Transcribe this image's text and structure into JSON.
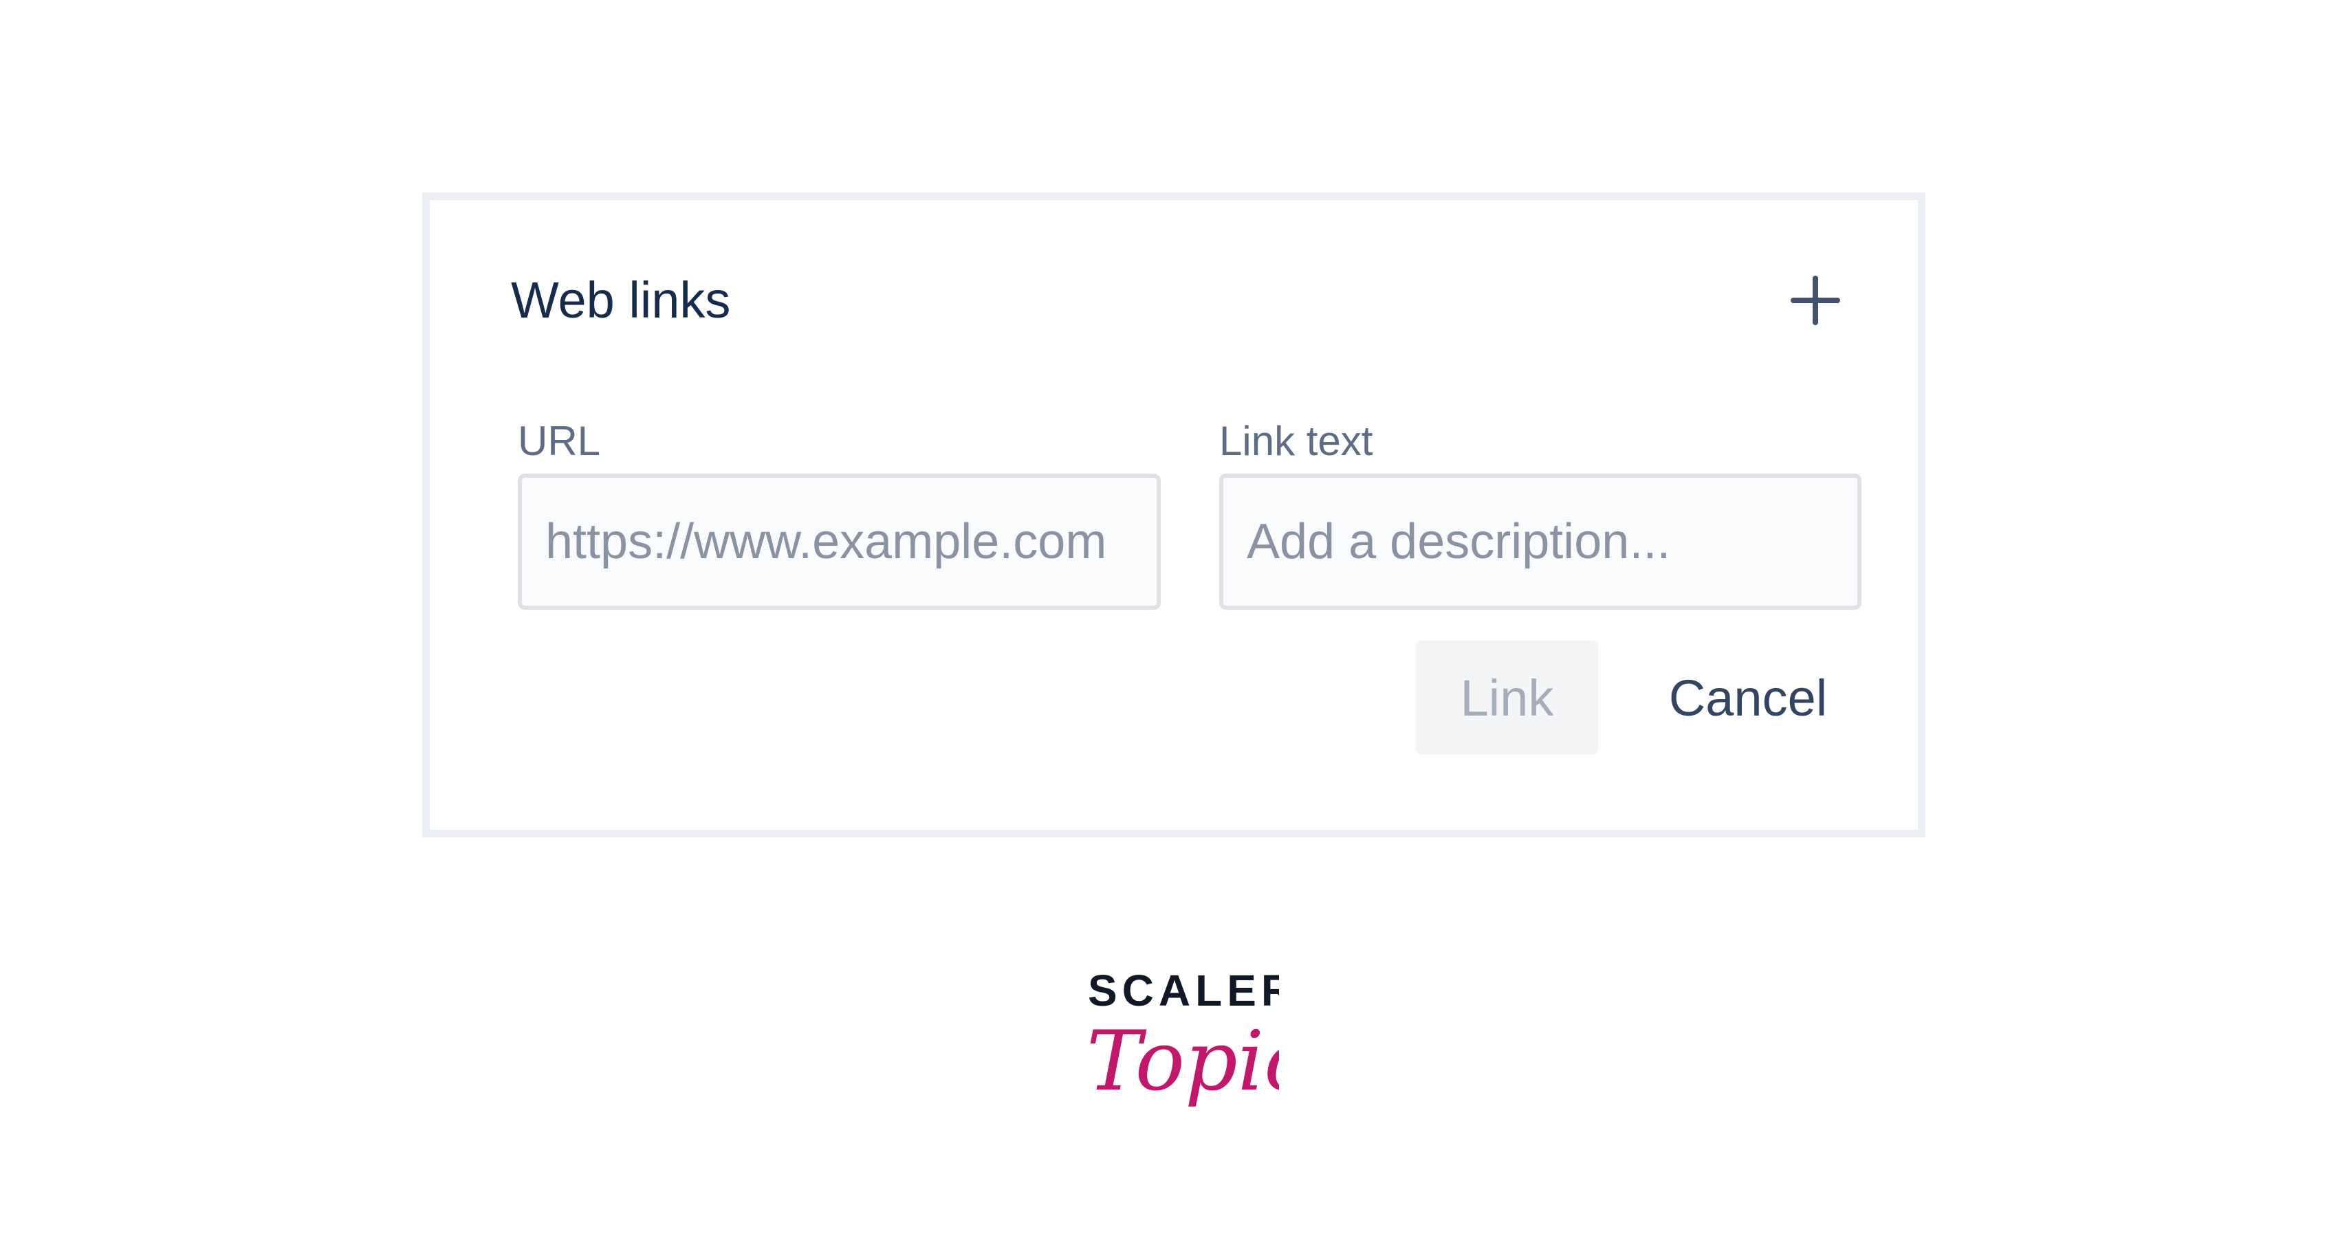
{
  "panel": {
    "title": "Web links",
    "add_icon": "plus-icon",
    "url_field": {
      "label": "URL",
      "placeholder": "https://www.example.com",
      "value": ""
    },
    "link_text_field": {
      "label": "Link text",
      "placeholder": "Add a description...",
      "value": ""
    },
    "link_button": "Link",
    "cancel_button": "Cancel"
  },
  "brand": {
    "line1": "SCALER",
    "line2": "Topics",
    "colors": {
      "line1": "#111827",
      "line2": "#c3176c"
    }
  },
  "colors": {
    "panel_border": "#ebeff4",
    "title": "#172b4d",
    "label": "#5e6c84",
    "input_border": "#dfe1e6",
    "input_background": "#fafbfc",
    "placeholder": "#8993a4",
    "disabled_button_bg": "#f4f5f7",
    "disabled_button_text": "#a5adba",
    "cancel_text": "#344563"
  }
}
